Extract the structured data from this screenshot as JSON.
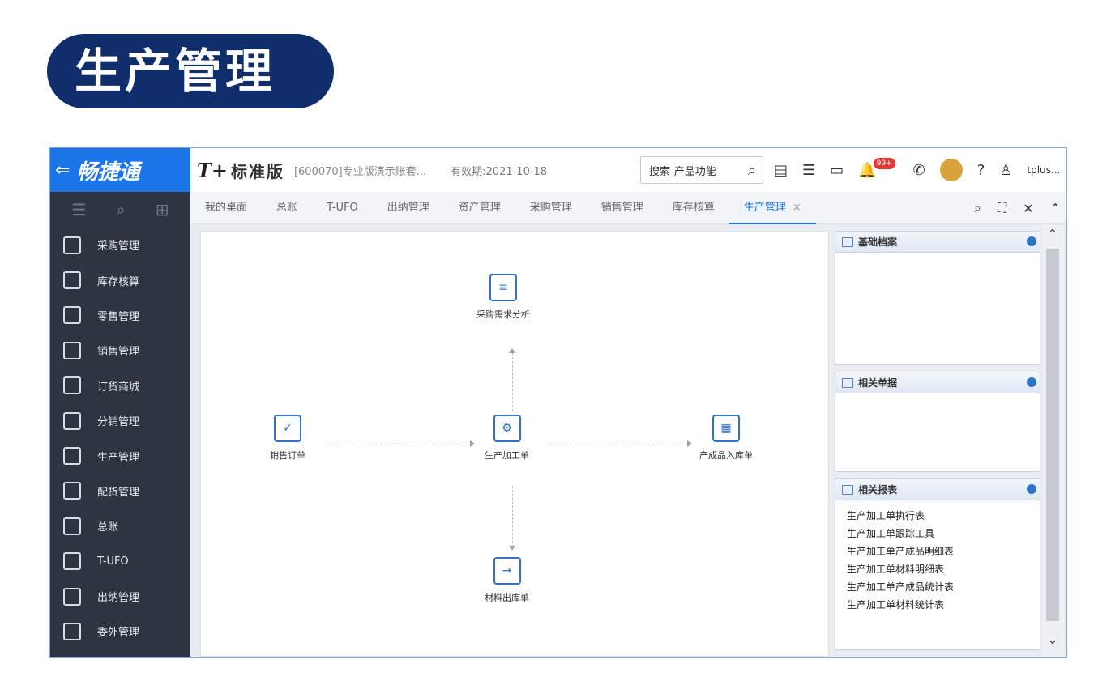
{
  "banner": {
    "title": "生产管理"
  },
  "app": {
    "brand": "畅捷通",
    "logo": "T+",
    "edition": "标准版",
    "account": "[600070]专业版演示账套...",
    "valid": "有效期:2021-10-18",
    "search_placeholder": "搜索-产品功能",
    "notification_count": "99+",
    "user": "tplus..."
  },
  "sidebar": {
    "items": [
      {
        "label": "采购管理",
        "icon": "cart-icon"
      },
      {
        "label": "库存核算",
        "icon": "inventory-icon"
      },
      {
        "label": "零售管理",
        "icon": "retail-icon"
      },
      {
        "label": "销售管理",
        "icon": "sales-chart-icon"
      },
      {
        "label": "订货商城",
        "icon": "store-icon"
      },
      {
        "label": "分销管理",
        "icon": "distribution-icon"
      },
      {
        "label": "生产管理",
        "icon": "production-icon"
      },
      {
        "label": "配货管理",
        "icon": "delivery-icon"
      },
      {
        "label": "总账",
        "icon": "ledger-icon"
      },
      {
        "label": "T-UFO",
        "icon": "ufo-icon"
      },
      {
        "label": "出纳管理",
        "icon": "cashier-icon"
      },
      {
        "label": "委外管理",
        "icon": "outsource-icon"
      }
    ]
  },
  "tabs": [
    {
      "label": "我的桌面"
    },
    {
      "label": "总账"
    },
    {
      "label": "T-UFO"
    },
    {
      "label": "出纳管理"
    },
    {
      "label": "资产管理"
    },
    {
      "label": "采购管理"
    },
    {
      "label": "销售管理"
    },
    {
      "label": "库存核算"
    },
    {
      "label": "生产管理",
      "active": true,
      "close": "×"
    }
  ],
  "flow": {
    "purchase_analysis": "采购需求分析",
    "sales_order": "销售订单",
    "production_order": "生产加工单",
    "finished_goods_in": "产成品入库单",
    "material_out": "材料出库单"
  },
  "panels": {
    "basic": {
      "title": "基础档案"
    },
    "docs": {
      "title": "相关单据"
    },
    "reports": {
      "title": "相关报表",
      "links": [
        "生产加工单执行表",
        "生产加工单跟踪工具",
        "生产加工单产成品明细表",
        "生产加工单材料明细表",
        "生产加工单产成品统计表",
        "生产加工单材料统计表"
      ]
    }
  }
}
